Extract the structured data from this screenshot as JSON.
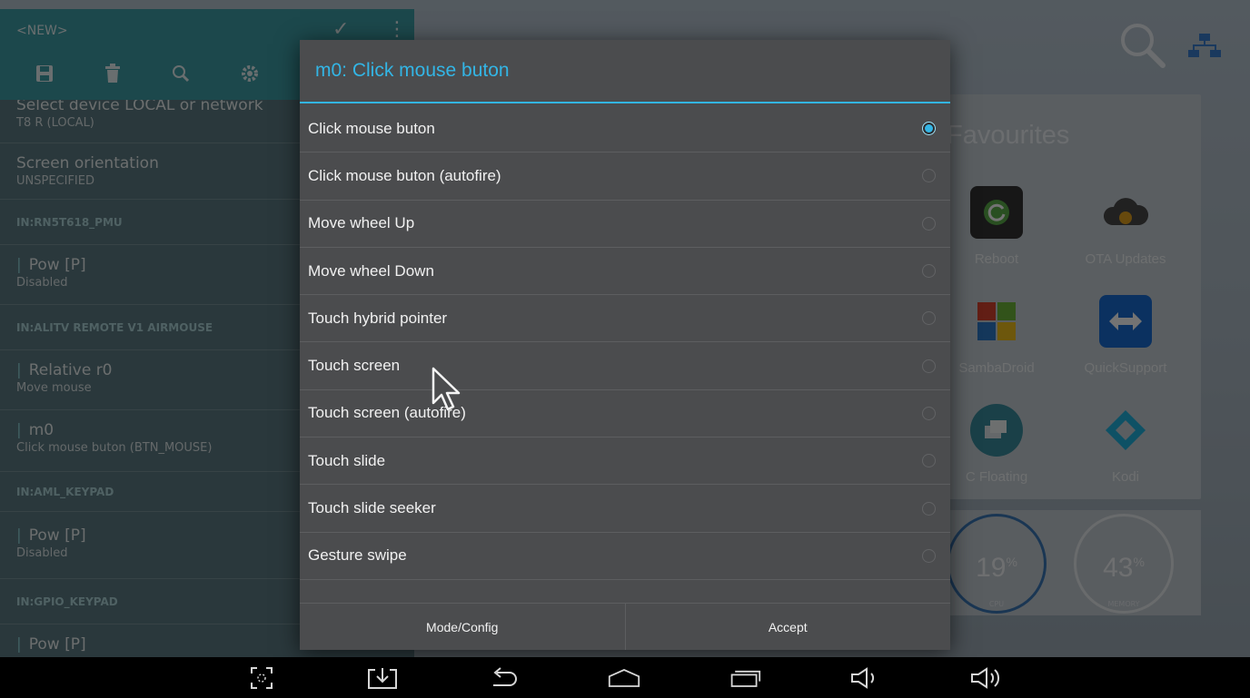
{
  "launcher": {
    "favourites_title": "Favourites",
    "apps": [
      {
        "name": "Reboot",
        "icon": "reboot-icon"
      },
      {
        "name": "OTA Updates",
        "icon": "cloud-gear-icon"
      },
      {
        "name": "SambaDroid",
        "icon": "sambadroid-icon"
      },
      {
        "name": "QuickSupport",
        "icon": "teamviewer-icon"
      },
      {
        "name": "C Floating",
        "icon": "floating-icon"
      },
      {
        "name": "Kodi",
        "icon": "kodi-icon"
      }
    ],
    "gauges": [
      {
        "value": "19",
        "unit": "%",
        "label": "CPU"
      },
      {
        "value": "43",
        "unit": "%",
        "label": "MEMORY"
      }
    ]
  },
  "left_panel": {
    "title": "<NEW>",
    "rows": [
      {
        "type": "item",
        "main": "Select device LOCAL or network",
        "sub": "T8 R (LOCAL)"
      },
      {
        "type": "item",
        "main": "Screen orientation",
        "sub": "UNSPECIFIED"
      },
      {
        "type": "header",
        "text": "IN:RN5T618_PMU"
      },
      {
        "type": "item",
        "main": "Pow [P]",
        "sub": "Disabled",
        "bar": true
      },
      {
        "type": "header",
        "text": "IN:ALITV REMOTE V1 AIRMOUSE"
      },
      {
        "type": "item",
        "main": "Relative r0",
        "sub": "Move mouse",
        "bar": true
      },
      {
        "type": "item",
        "main": "m0",
        "sub": "Click mouse buton (BTN_MOUSE)",
        "bar": true
      },
      {
        "type": "header",
        "text": "IN:AML_KEYPAD"
      },
      {
        "type": "item",
        "main": "Pow [P]",
        "sub": "Disabled",
        "bar": true
      },
      {
        "type": "header",
        "text": "IN:GPIO_KEYPAD"
      },
      {
        "type": "item",
        "main": "Pow [P]",
        "sub": "",
        "bar": true
      }
    ]
  },
  "dialog": {
    "title": "m0: Click mouse buton",
    "options": [
      {
        "label": "Click mouse buton",
        "selected": true
      },
      {
        "label": "Click mouse buton (autofire)",
        "selected": false
      },
      {
        "label": "Move wheel Up",
        "selected": false
      },
      {
        "label": "Move wheel Down",
        "selected": false
      },
      {
        "label": "Touch hybrid pointer",
        "selected": false
      },
      {
        "label": "Touch screen",
        "selected": false
      },
      {
        "label": "Touch screen (autofire)",
        "selected": false
      },
      {
        "label": "Touch slide",
        "selected": false
      },
      {
        "label": "Touch slide seeker",
        "selected": false
      },
      {
        "label": "Gesture swipe",
        "selected": false
      }
    ],
    "buttons": {
      "mode_config": "Mode/Config",
      "accept": "Accept"
    }
  },
  "colors": {
    "accent": "#33b5e5",
    "dialog_bg": "#4b4c4e",
    "panel_bar": "#3f9fa8"
  }
}
